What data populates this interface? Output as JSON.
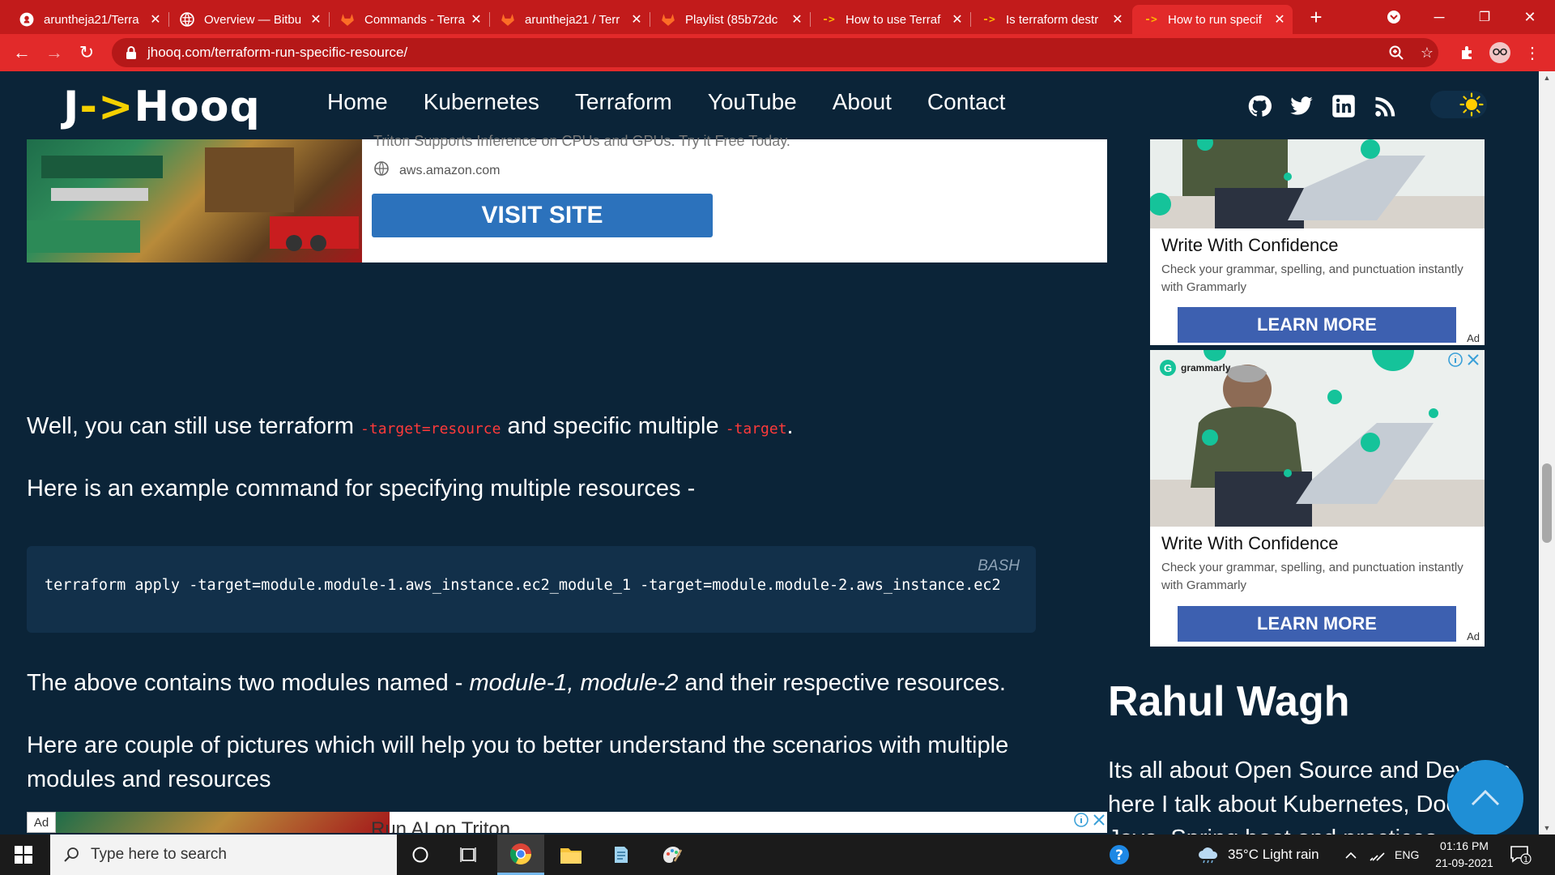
{
  "browser": {
    "tabs": [
      {
        "title": "aruntheja21/Terra",
        "icon": "github-icon"
      },
      {
        "title": "Overview — Bitbu",
        "icon": "bitbucket-icon"
      },
      {
        "title": "Commands - Terra",
        "icon": "gitlab-icon"
      },
      {
        "title": "aruntheja21 / Terr",
        "icon": "gitlab-icon"
      },
      {
        "title": "Playlist (85b72dc",
        "icon": "gitlab-icon"
      },
      {
        "title": "How to use Terraf",
        "icon": "jhooq-icon"
      },
      {
        "title": "Is terraform destr",
        "icon": "jhooq-icon"
      },
      {
        "title": "How to run specif",
        "icon": "jhooq-icon"
      }
    ],
    "favicon_jhooq": "->",
    "url": "jhooq.com/terraform-run-specific-resource/"
  },
  "site": {
    "logo": {
      "prefix": "J",
      "arrow": "->",
      "suffix": "Hooq"
    },
    "nav": [
      "Home",
      "Kubernetes",
      "Terraform",
      "YouTube",
      "About",
      "Contact"
    ]
  },
  "ad_top": {
    "cut_text": "Triton Supports Inference on CPUs and GPUs. Try it Free Today.",
    "domain": "aws.amazon.com",
    "button": "VISIT SITE"
  },
  "content": {
    "p1_before": "Well, you can still use terraform ",
    "p1_code1": "-target=resource",
    "p1_mid": " and specific multiple ",
    "p1_code2": "-target",
    "p1_end": ".",
    "p2": "Here is an example command for specifying multiple resources -",
    "code_lang": "BASH",
    "code": "terraform apply -target=module.module-1.aws_instance.ec2_module_1 -target=module.module-2.aws_instance.ec2",
    "p3_before": "The above contains two modules named - ",
    "p3_em": "module-1, module-2",
    "p3_after": " and their respective resources.",
    "p4_line1": "Here are couple of pictures which will help you to better understand the scenarios with multiple",
    "p4_line2": "modules and resources"
  },
  "ad_bottom": {
    "label": "Ad",
    "title": "Run AI on Triton"
  },
  "sidebar": {
    "ad1": {
      "title": "Write With Confidence",
      "desc": "Check your grammar, spelling, and punctuation instantly with Grammarly",
      "button": "LEARN MORE",
      "tag": "Ad"
    },
    "ad2": {
      "brand": "grammarly",
      "title": "Write With Confidence",
      "desc": "Check your grammar, spelling, and punctuation instantly with Grammarly",
      "button": "LEARN MORE",
      "tag": "Ad"
    },
    "author": "Rahul Wagh",
    "bio_line1": "Its all about Open Source and DevOps,",
    "bio_line2": "here I talk about Kubernetes, Docker,",
    "bio_line3": "Java, Spring boot and practices."
  },
  "taskbar": {
    "search_placeholder": "Type here to search",
    "weather": "35°C  Light rain",
    "lang": "ENG",
    "time": "01:16 PM",
    "date": "21-09-2021",
    "notification_count": "1"
  },
  "colors": {
    "accent": "#e22a2a",
    "page_bg": "#0b2438",
    "code_red": "#ff3a3a",
    "button_blue": "#2c72bc",
    "grammarly_green": "#15c39a"
  }
}
